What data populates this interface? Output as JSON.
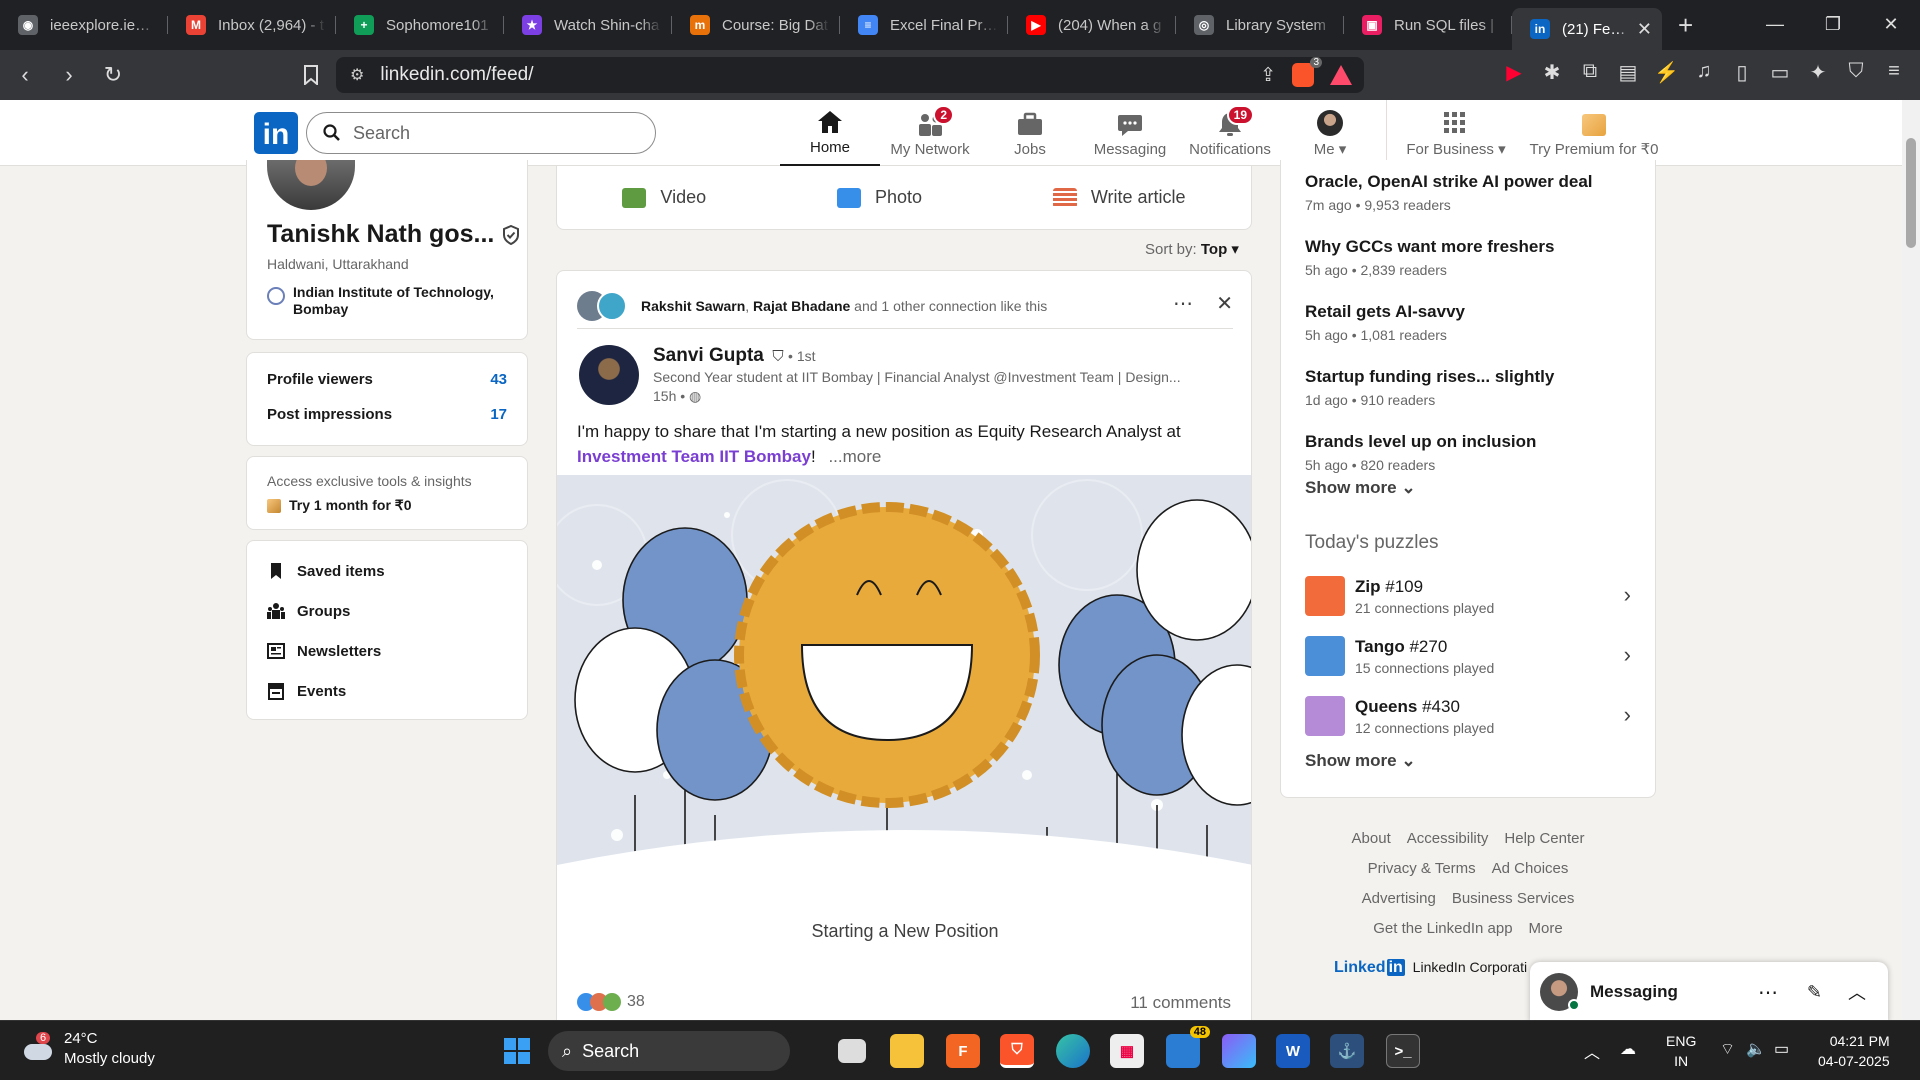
{
  "browser": {
    "tabs": [
      {
        "title": "ieeexplore.ieee.o",
        "color": "#5f6368",
        "glyph": "◉"
      },
      {
        "title": "Inbox (2,964) - t",
        "color": "#ea4335",
        "glyph": "M"
      },
      {
        "title": "Sophomore101",
        "color": "#0f9d58",
        "glyph": "+"
      },
      {
        "title": "Watch Shin-cha",
        "color": "#7b3fe4",
        "glyph": "★"
      },
      {
        "title": "Course: Big Dat",
        "color": "#e8710a",
        "glyph": "m"
      },
      {
        "title": "Excel Final Proje",
        "color": "#4285f4",
        "glyph": "≡"
      },
      {
        "title": "(204) When a g",
        "color": "#ff0000",
        "glyph": "▶"
      },
      {
        "title": "Library System",
        "color": "#5f6368",
        "glyph": "◎"
      },
      {
        "title": "Run SQL files |",
        "color": "#e91e63",
        "glyph": "▣"
      }
    ],
    "active_tab": {
      "title": "(21) Feed |",
      "glyph": "in"
    },
    "url": "linkedin.com/feed/",
    "brave_badge": "3"
  },
  "linkedin": {
    "search_placeholder": "Search",
    "nav": [
      {
        "label": "Home",
        "badge": "",
        "active": true
      },
      {
        "label": "My Network",
        "badge": "2"
      },
      {
        "label": "Jobs",
        "badge": ""
      },
      {
        "label": "Messaging",
        "badge": ""
      },
      {
        "label": "Notifications",
        "badge": "19"
      },
      {
        "label": "Me",
        "badge": ""
      }
    ],
    "for_business": "For Business",
    "premium": "Try Premium for ₹0"
  },
  "profile": {
    "name": "Tanishk Nath gos...",
    "location": "Haldwani, Uttarakhand",
    "institute": "Indian Institute of Technology, Bombay",
    "profile_viewers_label": "Profile viewers",
    "profile_viewers": "43",
    "post_impressions_label": "Post impressions",
    "post_impressions": "17",
    "premium_text": "Access exclusive tools & insights",
    "premium_cta": "Try 1 month for ₹0",
    "shortcuts": [
      "Saved items",
      "Groups",
      "Newsletters",
      "Events"
    ]
  },
  "composer": {
    "video": "Video",
    "photo": "Photo",
    "article": "Write article",
    "sort_label": "Sort by:",
    "sort_value": "Top"
  },
  "post": {
    "social_a": "Rakshit Sawarn",
    "social_sep": ", ",
    "social_b": "Rajat Bhadane",
    "social_rest": " and 1 other connection like this",
    "author": "Sanvi Gupta",
    "degree": "• 1st",
    "headline": "Second Year student at IIT Bombay | Financial Analyst @Investment Team | Design...",
    "time": "15h •",
    "text": "I'm happy to share that I'm starting a new position as Equity Research Analyst at ",
    "mention": "Investment Team IIT Bombay",
    "text_end": "!",
    "more": "...more",
    "caption": "Starting a New Position",
    "reactions": "38",
    "comments": "11 comments"
  },
  "news": {
    "items": [
      {
        "title": "Oracle, OpenAI strike AI power deal",
        "meta": "7m ago • 9,953 readers"
      },
      {
        "title": "Why GCCs want more freshers",
        "meta": "5h ago • 2,839 readers"
      },
      {
        "title": "Retail gets AI-savvy",
        "meta": "5h ago • 1,081 readers"
      },
      {
        "title": "Startup funding rises... slightly",
        "meta": "1d ago • 910 readers"
      },
      {
        "title": "Brands level up on inclusion",
        "meta": "5h ago • 820 readers"
      }
    ],
    "show_more": "Show more",
    "puzzles_title": "Today's puzzles",
    "puzzles": [
      {
        "name": "Zip",
        "num": "#109",
        "meta": "21 connections played",
        "color": "#f26c3b"
      },
      {
        "name": "Tango",
        "num": "#270",
        "meta": "15 connections played",
        "color": "#4b8fd8"
      },
      {
        "name": "Queens",
        "num": "#430",
        "meta": "12 connections played",
        "color": "#b58ad6"
      }
    ],
    "show_more_2": "Show more"
  },
  "footer": {
    "row1": [
      "About",
      "Accessibility",
      "Help Center"
    ],
    "row2": [
      "Privacy & Terms",
      "Ad Choices"
    ],
    "row3": [
      "Advertising",
      "Business Services"
    ],
    "row4": [
      "Get the LinkedIn app",
      "More"
    ],
    "brand": "LinkedIn Corporati",
    "logo_text": "Linked"
  },
  "messaging": {
    "label": "Messaging"
  },
  "taskbar": {
    "weather_badge": "6",
    "temp": "24°C",
    "condition": "Mostly cloudy",
    "search": "Search",
    "teams_badge": "48",
    "lang1": "ENG",
    "lang2": "IN",
    "time": "04:21 PM",
    "date": "04-07-2025"
  }
}
